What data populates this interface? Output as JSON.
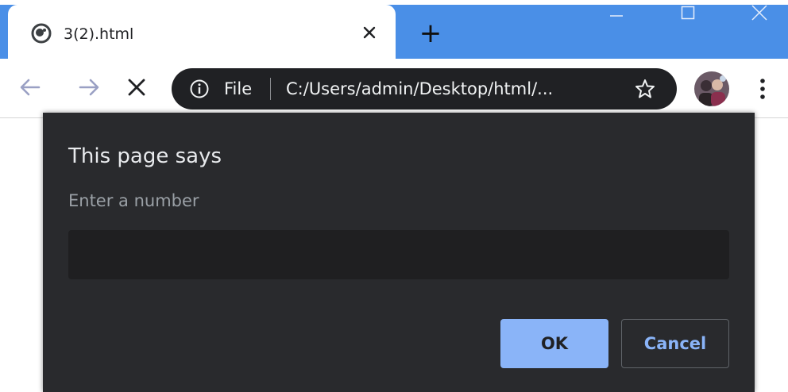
{
  "tab": {
    "title": "3(2).html",
    "favicon": "globe-icon",
    "close_icon": "close-icon"
  },
  "new_tab_label": "+",
  "window_controls": [
    "minimize-icon",
    "maximize-icon",
    "close-icon"
  ],
  "toolbar": {
    "back_icon": "back-arrow-icon",
    "forward_icon": "forward-arrow-icon",
    "stop_icon": "stop-icon"
  },
  "omnibox": {
    "scheme": "File",
    "url": "C:/Users/admin/Desktop/html/...",
    "info_icon": "info-icon",
    "bookmark_icon": "star-icon"
  },
  "dialog": {
    "title": "This page says",
    "message": "Enter a number",
    "input_value": "",
    "ok_label": "OK",
    "cancel_label": "Cancel"
  },
  "colors": {
    "titlebar": "#4a8fe7",
    "omnibox": "#202124",
    "dialog_bg": "#292a2d",
    "input_bg": "#1f1f21",
    "accent": "#8ab4f8"
  }
}
